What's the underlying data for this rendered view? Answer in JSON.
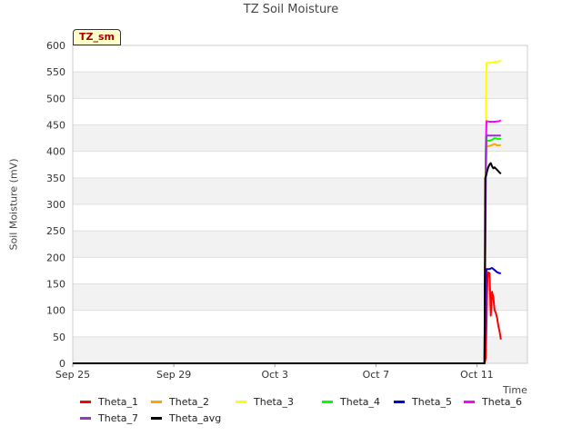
{
  "chart_data": {
    "type": "line",
    "title": "TZ Soil Moisture",
    "tag_label": "TZ_sm",
    "xlabel": "Time",
    "ylabel": "Soil Moisture (mV)",
    "ylim": [
      0,
      600
    ],
    "yticks": [
      0,
      50,
      100,
      150,
      200,
      250,
      300,
      350,
      400,
      450,
      500,
      550,
      600
    ],
    "xlim_days": [
      0,
      18
    ],
    "xticks": [
      {
        "label": "Sep 25",
        "day": 0
      },
      {
        "label": "Sep 29",
        "day": 4
      },
      {
        "label": "Oct 3",
        "day": 8
      },
      {
        "label": "Oct 7",
        "day": 12
      },
      {
        "label": "Oct 11",
        "day": 16
      }
    ],
    "grid": "horizontal-bands",
    "legend_position": "bottom",
    "series": [
      {
        "name": "Theta_1",
        "color": "#ff0000",
        "x": [
          0,
          16.3,
          16.35,
          16.4,
          16.42,
          16.45,
          16.5,
          16.55,
          16.6,
          16.65,
          16.7,
          16.75,
          16.8,
          16.85,
          16.9,
          16.95
        ],
        "y": [
          0,
          0,
          10,
          130,
          160,
          172,
          170,
          90,
          135,
          125,
          100,
          95,
          85,
          70,
          60,
          45
        ]
      },
      {
        "name": "Theta_2",
        "color": "#ffa500",
        "x": [
          0,
          16.3,
          16.35,
          16.38,
          16.5,
          16.6,
          16.7,
          16.8,
          16.9,
          16.95
        ],
        "y": [
          0,
          0,
          300,
          410,
          410,
          412,
          414,
          411,
          412,
          411
        ]
      },
      {
        "name": "Theta_3",
        "color": "#ffff00",
        "x": [
          0,
          16.3,
          16.35,
          16.38,
          16.5,
          16.7,
          16.9,
          16.95
        ],
        "y": [
          0,
          0,
          450,
          567,
          567,
          569,
          570,
          572
        ]
      },
      {
        "name": "Theta_4",
        "color": "#00ff00",
        "x": [
          0,
          16.3,
          16.35,
          16.38,
          16.5,
          16.6,
          16.7,
          16.8,
          16.9,
          16.95
        ],
        "y": [
          0,
          0,
          350,
          420,
          420,
          422,
          425,
          424,
          424,
          423
        ]
      },
      {
        "name": "Theta_5",
        "color": "#0000cc",
        "x": [
          0,
          16.3,
          16.35,
          16.38,
          16.5,
          16.6,
          16.7,
          16.8,
          16.9,
          16.95
        ],
        "y": [
          0,
          0,
          150,
          178,
          178,
          180,
          176,
          172,
          170,
          170
        ]
      },
      {
        "name": "Theta_6",
        "color": "#ff00ff",
        "x": [
          0,
          16.3,
          16.35,
          16.38,
          16.5,
          16.7,
          16.9,
          16.95
        ],
        "y": [
          0,
          0,
          400,
          457,
          456,
          456,
          457,
          459
        ]
      },
      {
        "name": "Theta_7",
        "color": "#9933cc",
        "x": [
          0,
          16.3,
          16.35,
          16.38,
          16.5,
          16.7,
          16.9,
          16.95
        ],
        "y": [
          0,
          0,
          380,
          430,
          430,
          430,
          430,
          430
        ]
      },
      {
        "name": "Theta_avg",
        "color": "#000000",
        "x": [
          0,
          16.3,
          16.33,
          16.37,
          16.4,
          16.45,
          16.5,
          16.55,
          16.6,
          16.65,
          16.7,
          16.8,
          16.9,
          16.95
        ],
        "y": [
          0,
          0,
          350,
          355,
          362,
          370,
          375,
          378,
          372,
          368,
          370,
          365,
          360,
          358
        ]
      }
    ]
  }
}
